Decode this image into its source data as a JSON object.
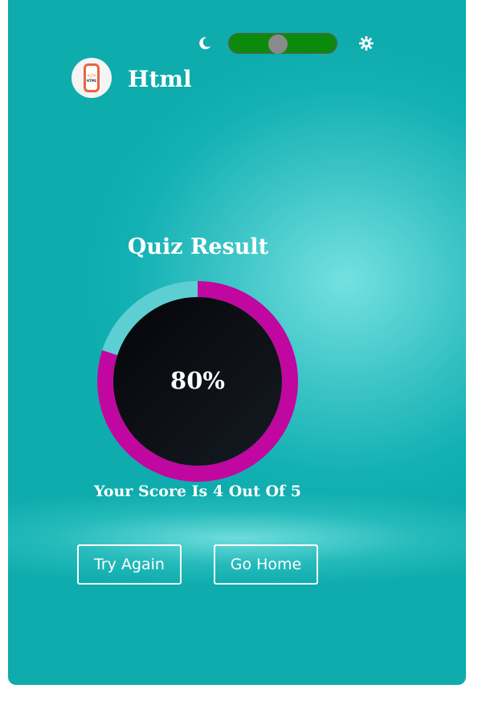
{
  "header": {
    "theme_toggle": {
      "state": "on",
      "color": "#0b8a0b",
      "knob_color": "#8a8a8a"
    },
    "moon_icon": "moon-icon",
    "sun_icon": "gear-sun-icon"
  },
  "app": {
    "logo_text": "HTML",
    "logo_code": "</>",
    "title": "Html"
  },
  "result": {
    "heading": "Quiz Result",
    "percent_label": "80%",
    "percent_value": 0.8,
    "score_text": "Your Score Is 4 Out Of 5",
    "progress_color": "#c0079f",
    "track_color": "#5dcfd2"
  },
  "actions": {
    "try_again": "Try Again",
    "go_home": "Go Home"
  }
}
